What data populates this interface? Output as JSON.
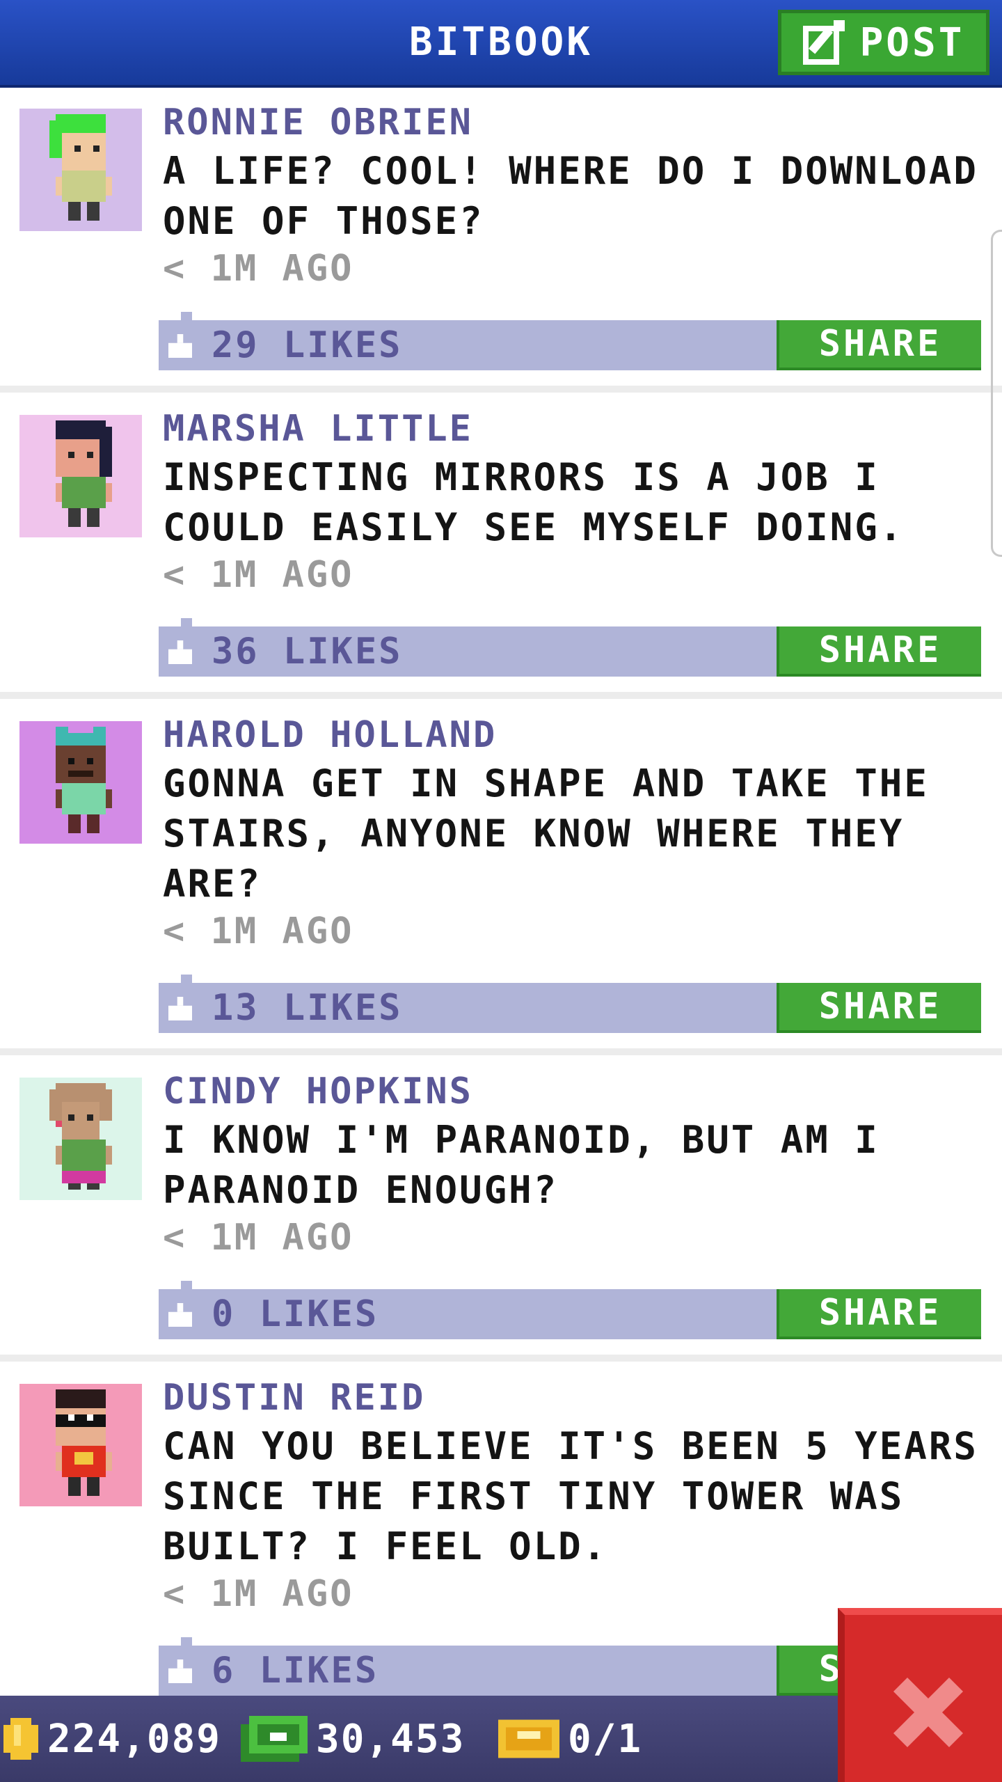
{
  "header": {
    "title": "BITBOOK",
    "post_label": "POST"
  },
  "posts": [
    {
      "author": "RONNIE OBRIEN",
      "message": "A LIFE? COOL! WHERE DO I DOWNLOAD ONE OF THOSE?",
      "time": "< 1M AGO",
      "likes": "29 LIKES",
      "share_label": "SHARE",
      "avatar_bg": "#d3bdea",
      "hair": "#3de03d",
      "skin": "#f0c9a0",
      "shirt": "#c9cf8a"
    },
    {
      "author": "MARSHA LITTLE",
      "message": "INSPECTING MIRRORS IS A JOB I COULD EASILY SEE MYSELF DOING.",
      "time": "< 1M AGO",
      "likes": "36 LIKES",
      "share_label": "SHARE",
      "avatar_bg": "#f0c4ec",
      "hair": "#1e1e3a",
      "skin": "#e8a08a",
      "shirt": "#5aa04a"
    },
    {
      "author": "HAROLD HOLLAND",
      "message": "GONNA GET IN SHAPE AND TAKE THE STAIRS, ANYONE KNOW WHERE THEY ARE?",
      "time": "< 1M AGO",
      "likes": "13 LIKES",
      "share_label": "SHARE",
      "avatar_bg": "#d38be6",
      "hair": "#3fb8b0",
      "skin": "#6a4030",
      "shirt": "#7bd6a8"
    },
    {
      "author": "CINDY HOPKINS",
      "message": "I KNOW I'M PARANOID, BUT AM I PARANOID ENOUGH?",
      "time": "< 1M AGO",
      "likes": "0 LIKES",
      "share_label": "SHARE",
      "avatar_bg": "#dcf5ea",
      "hair": "#b89070",
      "skin": "#c49a78",
      "shirt": "#5aa04a"
    },
    {
      "author": "DUSTIN REID",
      "message": "CAN YOU BELIEVE IT'S BEEN 5 YEARS SINCE THE FIRST TINY TOWER WAS BUILT? I FEEL OLD.",
      "time": "< 1M AGO",
      "likes": "6 LIKES",
      "share_label": "SHARE",
      "avatar_bg": "#f49ab8",
      "hair": "#2a1a1a",
      "skin": "#e8b090",
      "shirt": "#e0301e"
    }
  ],
  "footer": {
    "coins": "224,089",
    "bux": "30,453",
    "tickets": "0/1"
  },
  "colors": {
    "header": "#2a52c6",
    "share": "#43a838",
    "like_bar": "#b0b4d8",
    "author": "#5a5797",
    "footer": "#4a4a7e",
    "close": "#d62a2a"
  },
  "icons": {
    "post": "edit-icon",
    "like": "thumbs-up-icon",
    "coin": "coin-icon",
    "bux": "bux-icon",
    "ticket": "ticket-icon",
    "close": "close-icon"
  }
}
